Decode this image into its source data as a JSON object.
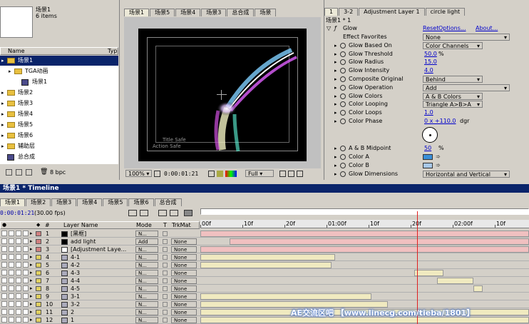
{
  "project": {
    "comp_name": "场景1",
    "items_count": "6 items",
    "col_name": "Name",
    "col_type": "Typ",
    "items": [
      {
        "label": "场景1",
        "kind": "folder",
        "indent": 0,
        "selected": true
      },
      {
        "label": "TGA动画",
        "kind": "folder",
        "indent": 1
      },
      {
        "label": "场景1",
        "kind": "comp",
        "indent": 2
      },
      {
        "label": "场景2",
        "kind": "folder",
        "indent": 0
      },
      {
        "label": "场景3",
        "kind": "folder",
        "indent": 0
      },
      {
        "label": "场景4",
        "kind": "folder",
        "indent": 0
      },
      {
        "label": "场景5",
        "kind": "folder",
        "indent": 0
      },
      {
        "label": "场景6",
        "kind": "folder",
        "indent": 0
      },
      {
        "label": "辅助层",
        "kind": "folder",
        "indent": 0
      },
      {
        "label": "总合成",
        "kind": "comp",
        "indent": 0
      }
    ],
    "bpc": "8 bpc"
  },
  "viewer": {
    "tabs": [
      "场景1",
      "场景5",
      "场景4",
      "场景3",
      "总合成",
      "场景"
    ],
    "zoom": "100%",
    "timecode": "0:00:01:21",
    "quality": "Full",
    "title_safe": "Title Safe",
    "action_safe": "Action Safe"
  },
  "effects": {
    "tabs": [
      "1",
      "3-2",
      "Adjustment Layer 1",
      "circle light"
    ],
    "breadcrumb": "场景1 * 1",
    "effect_name": "Glow",
    "reset": "Reset",
    "options": "Options...",
    "about": "About...",
    "props": [
      {
        "label": "Effect Favorites",
        "value": "None",
        "type": "dropdown-wide",
        "sw": false
      },
      {
        "label": "Glow Based On",
        "value": "Color Channels",
        "type": "dropdown",
        "sw": true
      },
      {
        "label": "Glow Threshold",
        "value": "50.0",
        "unit": "%",
        "type": "num",
        "sw": true
      },
      {
        "label": "Glow Radius",
        "value": "15.0",
        "type": "num",
        "sw": true
      },
      {
        "label": "Glow Intensity",
        "value": "4.0",
        "type": "num",
        "sw": true
      },
      {
        "label": "Composite Original",
        "value": "Behind",
        "type": "dropdown",
        "sw": true
      },
      {
        "label": "Glow Operation",
        "value": "Add",
        "type": "dropdown-wide",
        "sw": true
      },
      {
        "label": "Glow Colors",
        "value": "A & B Colors",
        "type": "dropdown",
        "sw": true
      },
      {
        "label": "Color Looping",
        "value": "Triangle A>B>A",
        "type": "dropdown",
        "sw": true
      },
      {
        "label": "Color Loops",
        "value": "1.0",
        "type": "num",
        "sw": true
      },
      {
        "label": "Color Phase",
        "value": "0 x +110.0",
        "unit": "dgr",
        "type": "num",
        "sw": true
      }
    ],
    "props2": [
      {
        "label": "A & B Midpoint",
        "value": "50",
        "unit": "%",
        "type": "num"
      },
      {
        "label": "Color A",
        "type": "color",
        "color": "#3a8fd8"
      },
      {
        "label": "Color B",
        "type": "color",
        "color": "#a8c8e8"
      },
      {
        "label": "Glow Dimensions",
        "value": "Horizontal and Vertical",
        "type": "dropdown-wide"
      }
    ]
  },
  "timeline": {
    "title": "场景1 * Timeline",
    "tabs": [
      "场景1",
      "场景2",
      "场景3",
      "场景4",
      "场景5",
      "场景6",
      "总合成"
    ],
    "timecode": "0:00:01:21",
    "fps": "(30.00 fps)",
    "col_hash": "#",
    "col_layer": "Layer Name",
    "col_mode": "Mode",
    "col_t": "T",
    "col_trkmat": "TrkMat",
    "ruler": [
      "00f",
      "10f",
      "20f",
      "01:00f",
      "10f",
      "20f",
      "02:00f",
      "10f"
    ],
    "layers": [
      {
        "num": "1",
        "name": "[黑框]",
        "mode": "N...",
        "trk": "",
        "color": "#d08080",
        "kind": "solid-black",
        "bar": "#f0c0c0",
        "start": 0,
        "end": 1
      },
      {
        "num": "2",
        "name": "add light",
        "mode": "Add",
        "trk": "None",
        "color": "#d08080",
        "kind": "solid-black",
        "bar": "#f0c0c0",
        "start": 0.09,
        "end": 1
      },
      {
        "num": "3",
        "name": "[Adjustment Laye...",
        "mode": "N...",
        "trk": "None",
        "color": "#d08080",
        "kind": "solid-white",
        "bar": "#f0c0c0",
        "start": 0,
        "end": 1
      },
      {
        "num": "4",
        "name": "4-1",
        "mode": "N...",
        "trk": "None",
        "color": "#e0d060",
        "kind": "comp",
        "bar": "#f0eac0",
        "start": 0,
        "end": 0.41
      },
      {
        "num": "5",
        "name": "4-2",
        "mode": "N...",
        "trk": "None",
        "color": "#e0d060",
        "kind": "comp",
        "bar": "#f0eac0",
        "start": 0,
        "end": 0.4
      },
      {
        "num": "6",
        "name": "4-3",
        "mode": "N...",
        "trk": "None",
        "color": "#e0d060",
        "kind": "comp",
        "bar": "#f0eac0",
        "start": 0.65,
        "end": 0.74
      },
      {
        "num": "7",
        "name": "4-4",
        "mode": "N...",
        "trk": "None",
        "color": "#e0d060",
        "kind": "comp",
        "bar": "#f0eac0",
        "start": 0.72,
        "end": 0.83
      },
      {
        "num": "8",
        "name": "4-5",
        "mode": "N...",
        "trk": "None",
        "color": "#e0d060",
        "kind": "comp",
        "bar": "#f0eac0",
        "start": 0.83,
        "end": 0.86
      },
      {
        "num": "9",
        "name": "3-1",
        "mode": "N...",
        "trk": "None",
        "color": "#e0d060",
        "kind": "comp",
        "bar": "#f0eac0",
        "start": 0,
        "end": 0.52
      },
      {
        "num": "10",
        "name": "3-2",
        "mode": "N...",
        "trk": "None",
        "color": "#e0d060",
        "kind": "comp",
        "bar": "#f0eac0",
        "start": 0,
        "end": 0.57
      },
      {
        "num": "11",
        "name": "2",
        "mode": "N...",
        "trk": "None",
        "color": "#e0d060",
        "kind": "comp",
        "bar": "#f0eac0",
        "start": 0,
        "end": 1
      },
      {
        "num": "12",
        "name": "1",
        "mode": "N...",
        "trk": "None",
        "color": "#e0d060",
        "kind": "comp",
        "bar": "#f0eac0",
        "start": 0,
        "end": 1
      }
    ],
    "playhead": 0.66
  },
  "watermark": "AE交流区吧 【www.linecg.com/tieba/1801】"
}
